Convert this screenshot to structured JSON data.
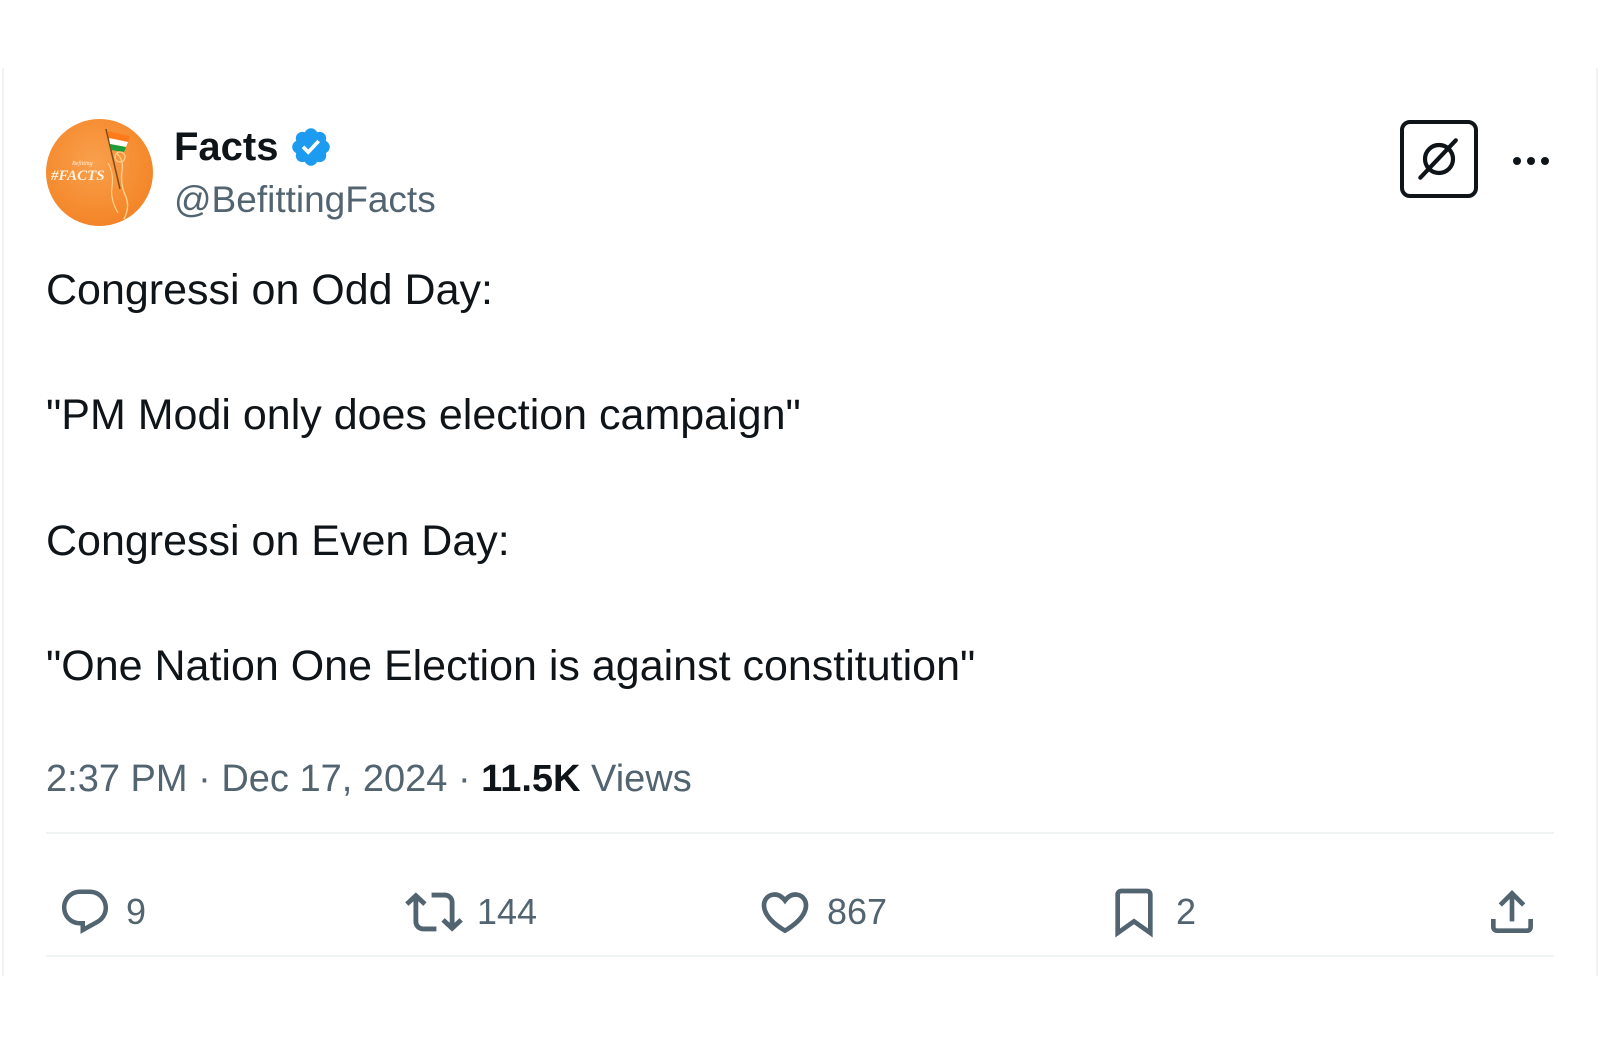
{
  "author": {
    "display_name": "Facts",
    "handle": "@BefittingFacts",
    "verified": true,
    "avatar_text": "#FACTS",
    "avatar_small_text": "Befitting",
    "avatar_color": "#f58a2e"
  },
  "tweet": {
    "lines": [
      "Congressi on Odd Day:",
      "\"PM Modi only does election campaign\"",
      "Congressi on Even Day:",
      "\"One Nation One Election is against constitution\""
    ]
  },
  "meta": {
    "time": "2:37 PM",
    "separator": "·",
    "date": "Dec 17, 2024",
    "views_count": "11.5K",
    "views_label": "Views"
  },
  "actions": {
    "replies": "9",
    "reposts": "144",
    "likes": "867",
    "bookmarks": "2"
  },
  "icons": {
    "verified": "verified-badge-icon",
    "grok": "grok-icon",
    "more": "more-options-icon",
    "reply": "reply-icon",
    "repost": "repost-icon",
    "like": "heart-icon",
    "bookmark": "bookmark-icon",
    "share": "share-icon"
  },
  "colors": {
    "text": "#0f1419",
    "secondary": "#536471",
    "verified_blue": "#1d9bf0",
    "divider": "#eff3f4"
  }
}
